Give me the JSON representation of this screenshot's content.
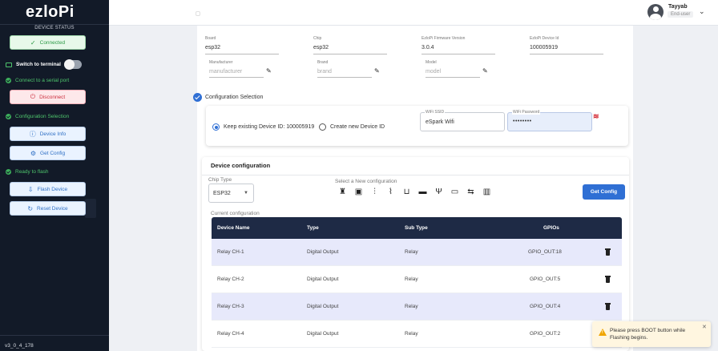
{
  "app": {
    "logo": "ezloPi",
    "version": "v3_0_4_178"
  },
  "sidebar": {
    "device_status": "DEVICE STATUS",
    "connected": "Connected",
    "switch_terminal": "Switch to terminal",
    "connect_serial": "Connect to a serial port",
    "disconnect": "Disconnect",
    "config_selection": "Configuration Selection",
    "device_info": "Device Info",
    "get_config": "Get Config",
    "ready_flash": "Ready to flash",
    "flash_device": "Flash Device",
    "reset_device": "Reset Device"
  },
  "header": {
    "user_name": "Tayyab",
    "user_role": "End-user"
  },
  "device_fields": {
    "board_label": "Board",
    "board": "esp32",
    "chip_label": "Chip",
    "chip": "esp32",
    "fw_label": "EzloPi Firmware Version",
    "fw": "3.0.4",
    "id_label": "EzloPi Device Id",
    "id": "100005919",
    "manufacturer_label": "Manufacturer",
    "manufacturer_ph": "manufacturer",
    "brand_label": "Brand",
    "brand_ph": "brand",
    "model_label": "Model",
    "model_ph": "model"
  },
  "config_selection": {
    "title": "Configuration Selection",
    "keep_existing": "Keep existing Device ID: 100005919",
    "create_new": "Create new Device ID",
    "wifi_ssid_label": "WiFi SSID",
    "wifi_ssid": "eSpark Wifi",
    "wifi_password_label": "WiFi Password",
    "wifi_password": "••••••••"
  },
  "device_config": {
    "title": "Device configuration",
    "chip_type_label": "Chip Type",
    "chip_type": "ESP32",
    "select_new_label": "Select a New configuration",
    "get_config_button": "Get Config",
    "current_label": "Current configuration",
    "icons": [
      "led-icon",
      "sensor-icon",
      "pwm-icon",
      "signal-icon",
      "bracket-icon",
      "connector-icon",
      "antenna-icon",
      "display-icon",
      "swap-icon",
      "relay-icon"
    ],
    "columns": {
      "name": "Device Name",
      "type": "Type",
      "subtype": "Sub Type",
      "gpios": "GPIOs"
    },
    "rows": [
      {
        "name": "Relay CH-1",
        "type": "Digital Output",
        "subtype": "Relay",
        "gpios": "GPIO_OUT:18"
      },
      {
        "name": "Relay CH-2",
        "type": "Digital Output",
        "subtype": "Relay",
        "gpios": "GPIO_OUT:5"
      },
      {
        "name": "Relay CH-3",
        "type": "Digital Output",
        "subtype": "Relay",
        "gpios": "GPIO_OUT:4"
      },
      {
        "name": "Relay CH-4",
        "type": "Digital Output",
        "subtype": "Relay",
        "gpios": "GPIO_OUT:2"
      }
    ]
  },
  "toast": {
    "message": "Please press BOOT button while Flashing begins."
  },
  "colors": {
    "sidebar_bg": "#121a28",
    "accent": "#2f6fd4",
    "table_header": "#1e2a45",
    "row_alt": "#e7e9fb"
  }
}
